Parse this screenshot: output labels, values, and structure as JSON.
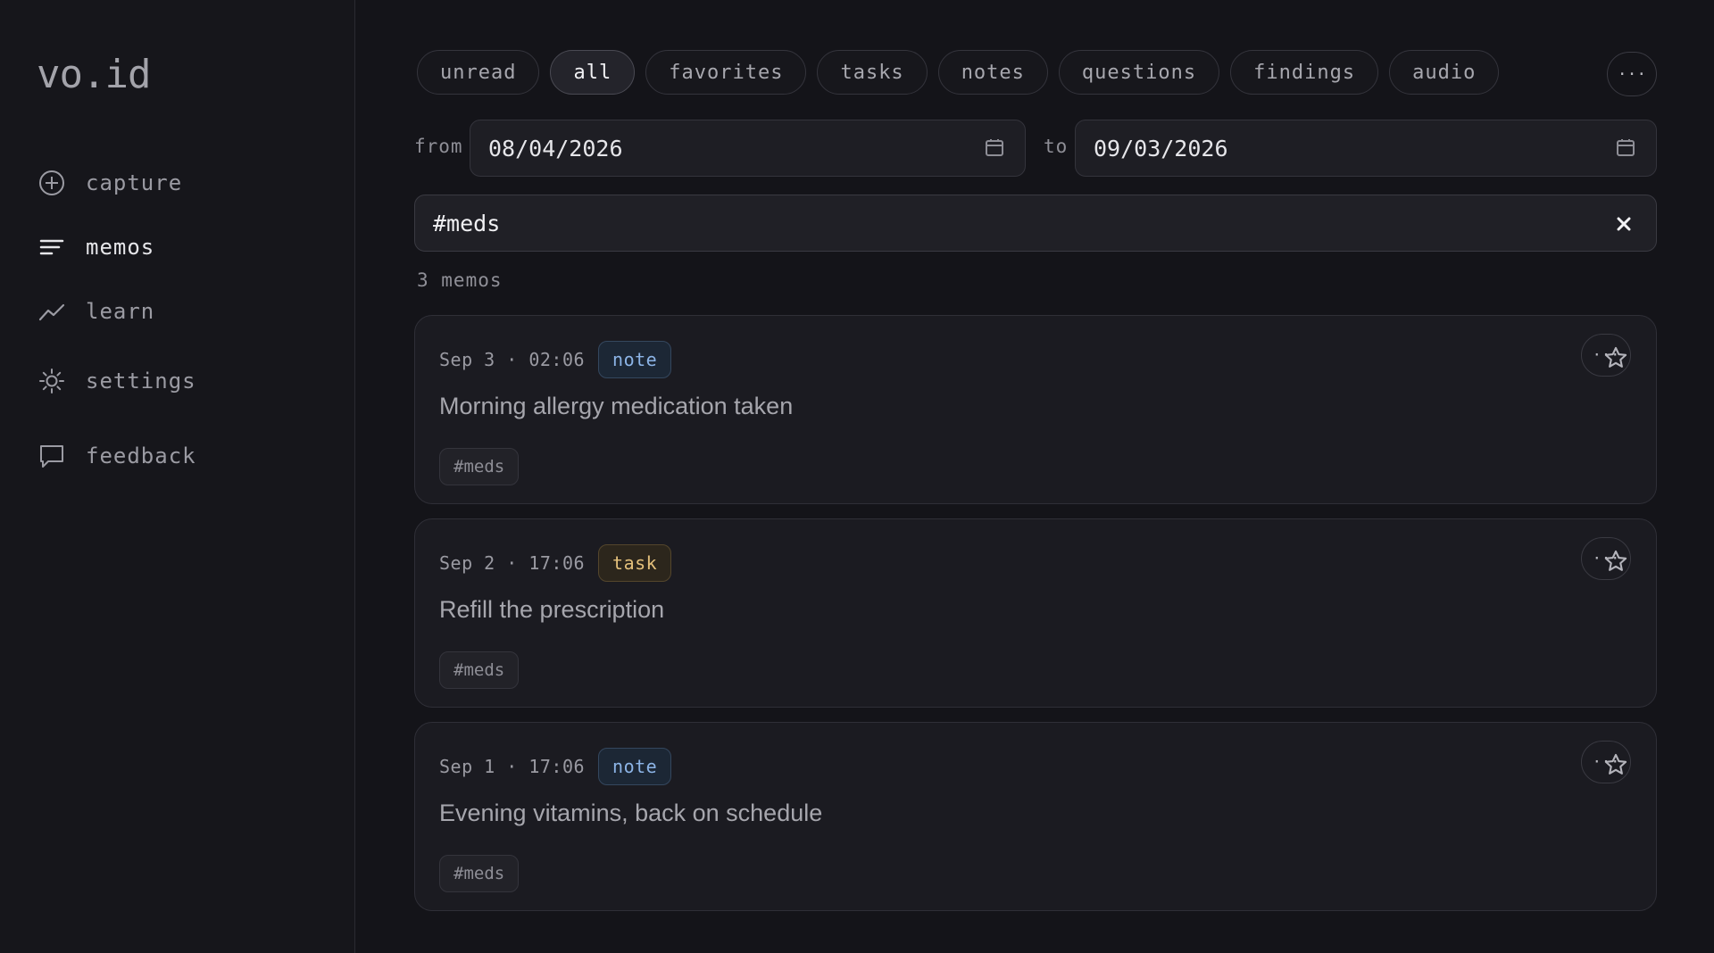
{
  "app": {
    "logo": "vo.id"
  },
  "sidebar": {
    "items": [
      {
        "label": "capture",
        "icon": "plus-circle-icon"
      },
      {
        "label": "memos",
        "icon": "lines-icon"
      },
      {
        "label": "learn",
        "icon": "trend-icon"
      },
      {
        "label": "settings",
        "icon": "sun-gear-icon"
      },
      {
        "label": "feedback",
        "icon": "chat-icon"
      }
    ],
    "active": "memos"
  },
  "filters": {
    "chips": [
      "unread",
      "all",
      "favorites",
      "tasks",
      "notes",
      "questions",
      "findings",
      "audio"
    ],
    "active": "all",
    "more_label": "···"
  },
  "date_range": {
    "from_label": "from",
    "from_value": "08/04/2026",
    "to_label": "to",
    "to_value": "09/03/2026"
  },
  "search": {
    "value": "#meds",
    "clear_label": "✕"
  },
  "results": {
    "count_text": "3 memos"
  },
  "memos": [
    {
      "time": "Sep 3 · 02:06",
      "type": "note",
      "text": "Morning allergy medication taken",
      "tag": "#meds"
    },
    {
      "time": "Sep 2 · 17:06",
      "type": "task",
      "text": "Refill the prescription",
      "tag": "#meds"
    },
    {
      "time": "Sep 1 · 17:06",
      "type": "note",
      "text": "Evening vitamins, back on schedule",
      "tag": "#meds"
    }
  ],
  "colors": {
    "background": "#141419",
    "sidebar": "#16161b",
    "note_badge": "#8cb4e6",
    "task_badge": "#e4c07b"
  }
}
